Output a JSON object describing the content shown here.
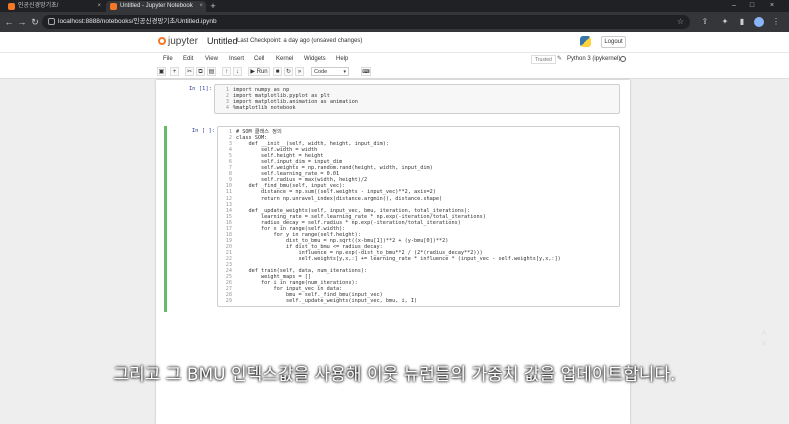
{
  "browser": {
    "tabs": [
      {
        "label": "인공신경망기초/"
      },
      {
        "label": "Untitled - Jupyter Notebook"
      }
    ],
    "new_tab": "+",
    "url": "localhost:8888/notebooks/인공신경망기초/Untitled.ipynb"
  },
  "jupyter": {
    "logo": "jupyter",
    "notebook_title": "Untitled",
    "checkpoint": "Last Checkpoint: a day ago  (unsaved changes)",
    "logout": "Logout",
    "menu": [
      "File",
      "Edit",
      "View",
      "Insert",
      "Cell",
      "Kernel",
      "Widgets",
      "Help"
    ],
    "trusted": "Trusted",
    "kernel": "Python 3 (ipykernel)",
    "run_label": "Run",
    "cell_type": "Code"
  },
  "cells": [
    {
      "prompt": "In [1]:",
      "lines": [
        "import numpy as np",
        "import matplotlib.pyplot as plt",
        "import matplotlib.animation as animation",
        "%matplotlib notebook"
      ]
    },
    {
      "prompt": "In [ ]:",
      "lines": [
        "# SOM 클래스 정의",
        "class SOM:",
        "    def __init__(self, width, height, input_dim):",
        "        self.width = width",
        "        self.height = height",
        "        self.input_dim = input_dim",
        "        self.weights = np.random.rand(height, width, input_dim)",
        "        self.learning_rate = 0.01",
        "        self.radius = max(width, height)/2",
        "    def _find_bmu(self, input_vec):",
        "        distance = np.sum((self.weights - input_vec)**2, axis=2)",
        "        return np.unravel_index(distance.argmin(), distance.shape)",
        "",
        "    def _update_weights(self, input_vec, bmu, iteration, total_iterations):",
        "        learning_rate = self.learning_rate * np.exp(-iteration/total_iterations)",
        "        radius_decay = self.radius * np.exp(-iteration/total_iterations)",
        "        for x in range(self.width):",
        "            for y in range(self.height):",
        "                dist_to_bmu = np.sqrt((x-bmu[1])**2 + (y-bmu[0])**2)",
        "                if dist_to_bmu <= radius_decay:",
        "                    influence = np.exp(-dist_to_bmu**2 / (2*(radius_decay**2)))",
        "                    self.weights[y,x,:] += learning_rate * influence * (input_vec - self.weights[y,x,:])",
        "",
        "    def train(self, data, num_iterations):",
        "        weight_maps = []",
        "        for i in range(num_iterations):",
        "            for input_vec in data:",
        "                bmu = self._find_bmu(input_vec)",
        "                self._update_weights(input_vec, bmu, i, I)"
      ]
    }
  ],
  "subtitle": "그리고 그 BMU 인덱스값을 사용해 이웃 뉴런들의 가중치 값을 업데이트합니다."
}
